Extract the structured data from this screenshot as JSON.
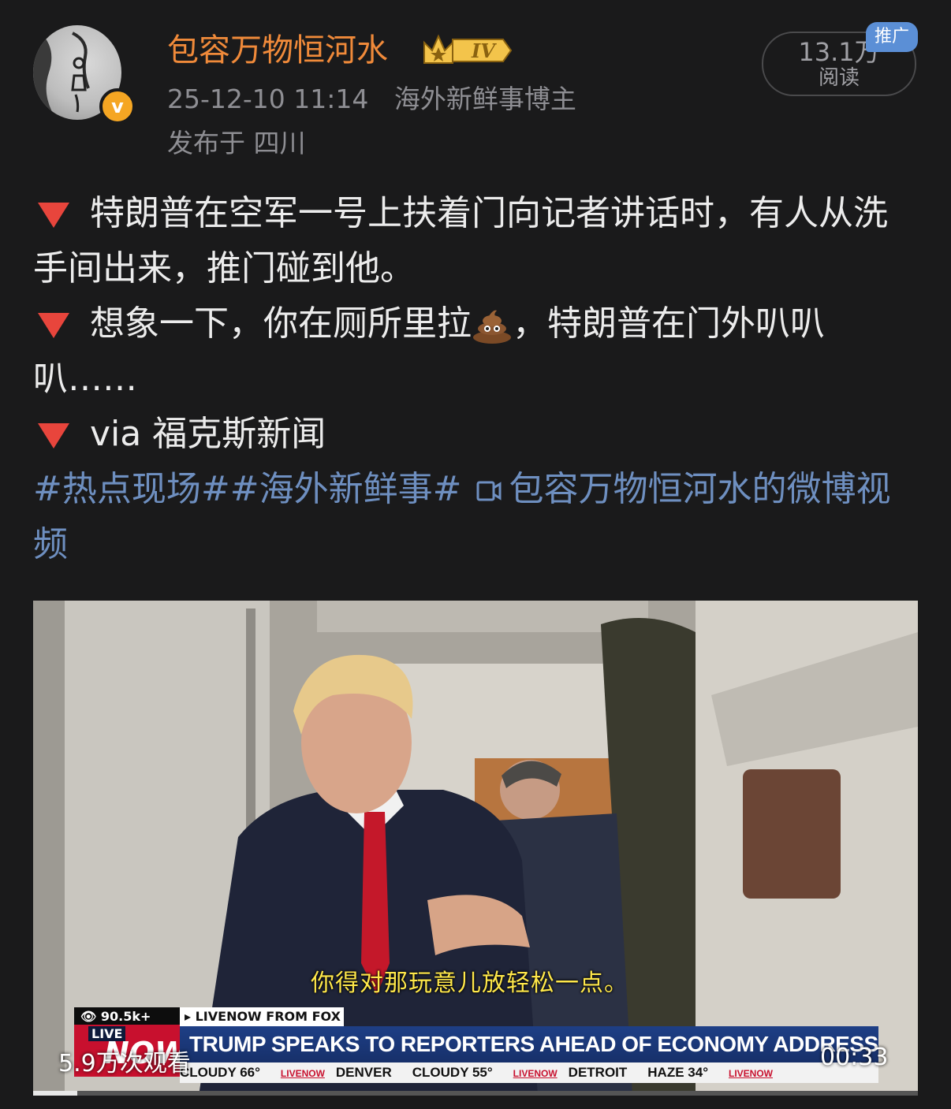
{
  "header": {
    "username": "包容万物恒河水",
    "vip_level": "IV",
    "timestamp": "25-12-10 11:14",
    "user_title": "海外新鲜事博主",
    "location": "发布于 四川",
    "read_count": "13.1万",
    "read_label": "阅读",
    "promo_label": "推广",
    "verified_symbol": "v"
  },
  "post": {
    "line1": "特朗普在空军一号上扶着门向记者讲话时，有人从洗手间出来，推门碰到他。",
    "line2_before": "想象一下，你在厕所里拉",
    "line2_after": "，特朗普在门外叭叭叭……",
    "line3": "via 福克斯新闻",
    "hashtags": "#热点现场##海外新鲜事#",
    "video_link": "包容万物恒河水的微博视频",
    "bullet_icon": "red-triangle-down",
    "emoji_icon": "poop-emoji"
  },
  "video": {
    "subtitle": "你得对那玩意儿放轻松一点。",
    "viewer_count": "👁 90.5k+",
    "livenow_label": "▸ LIVENOW FROM FOX",
    "live_word": "LIVE",
    "now_word": "NOW",
    "headline": "TRUMP SPEAKS TO REPORTERS AHEAD OF ECONOMY ADDRESS IN PA",
    "weather": [
      {
        "text": "CLOUDY 66°"
      },
      {
        "text": "DENVER"
      },
      {
        "text": "CLOUDY 55°"
      },
      {
        "text": "DETROIT"
      },
      {
        "text": "HAZE 34°"
      }
    ],
    "mini_logo": "LIVENOW",
    "views": "5.9万次观看",
    "duration": "00:33",
    "progress": 0.05
  }
}
